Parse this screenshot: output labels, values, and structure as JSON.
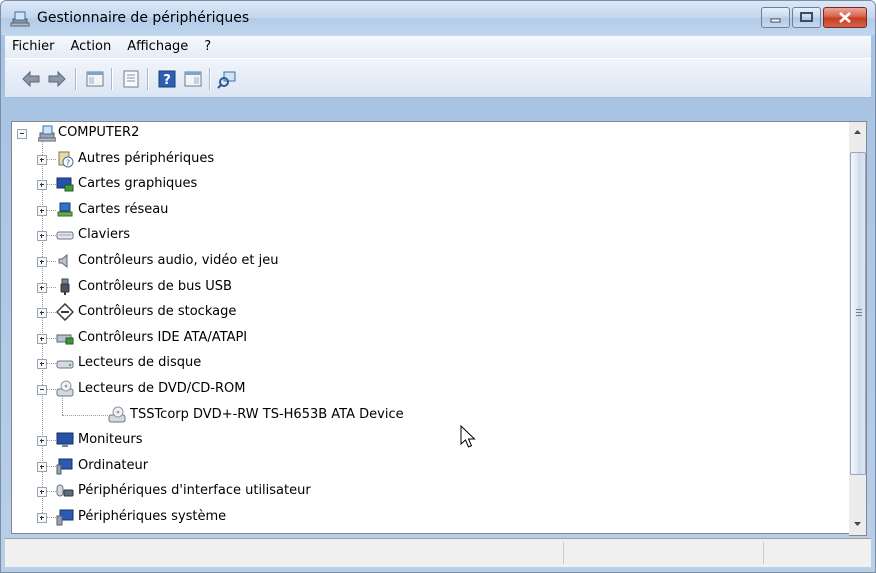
{
  "window": {
    "title": "Gestionnaire de périphériques"
  },
  "menu": [
    "Fichier",
    "Action",
    "Affichage",
    "?"
  ],
  "toolbar": {
    "buttons": [
      "back-icon",
      "forward-icon",
      "show-hide-tree-icon",
      "properties-icon",
      "help-icon",
      "action-pane-icon",
      "scan-hardware-icon"
    ]
  },
  "tree": {
    "root": "COMPUTER2",
    "categories": [
      {
        "label": "Autres périphériques",
        "icon": "unknown-device-icon",
        "expanded": false
      },
      {
        "label": "Cartes graphiques",
        "icon": "display-adapter-icon",
        "expanded": false
      },
      {
        "label": "Cartes réseau",
        "icon": "network-adapter-icon",
        "expanded": false
      },
      {
        "label": "Claviers",
        "icon": "keyboard-icon",
        "expanded": false
      },
      {
        "label": "Contrôleurs audio, vidéo et jeu",
        "icon": "speaker-icon",
        "expanded": false
      },
      {
        "label": "Contrôleurs de bus USB",
        "icon": "usb-icon",
        "expanded": false
      },
      {
        "label": "Contrôleurs de stockage",
        "icon": "storage-controller-icon",
        "expanded": false
      },
      {
        "label": "Contrôleurs IDE ATA/ATAPI",
        "icon": "ide-controller-icon",
        "expanded": false
      },
      {
        "label": "Lecteurs de disque",
        "icon": "disk-drive-icon",
        "expanded": false
      },
      {
        "label": "Lecteurs de DVD/CD-ROM",
        "icon": "dvd-drive-icon",
        "expanded": true
      },
      {
        "label": "Moniteurs",
        "icon": "monitor-icon",
        "expanded": false
      },
      {
        "label": "Ordinateur",
        "icon": "computer-icon",
        "expanded": false
      },
      {
        "label": "Périphériques d'interface utilisateur",
        "icon": "hid-icon",
        "expanded": false
      },
      {
        "label": "Périphériques système",
        "icon": "system-device-icon",
        "expanded": false
      }
    ],
    "dvd_child": "TSSTcorp DVD+-RW TS-H653B ATA Device"
  },
  "colors": {
    "title_gradient_top": "#dbe8f7",
    "close_button": "#c43a20"
  }
}
